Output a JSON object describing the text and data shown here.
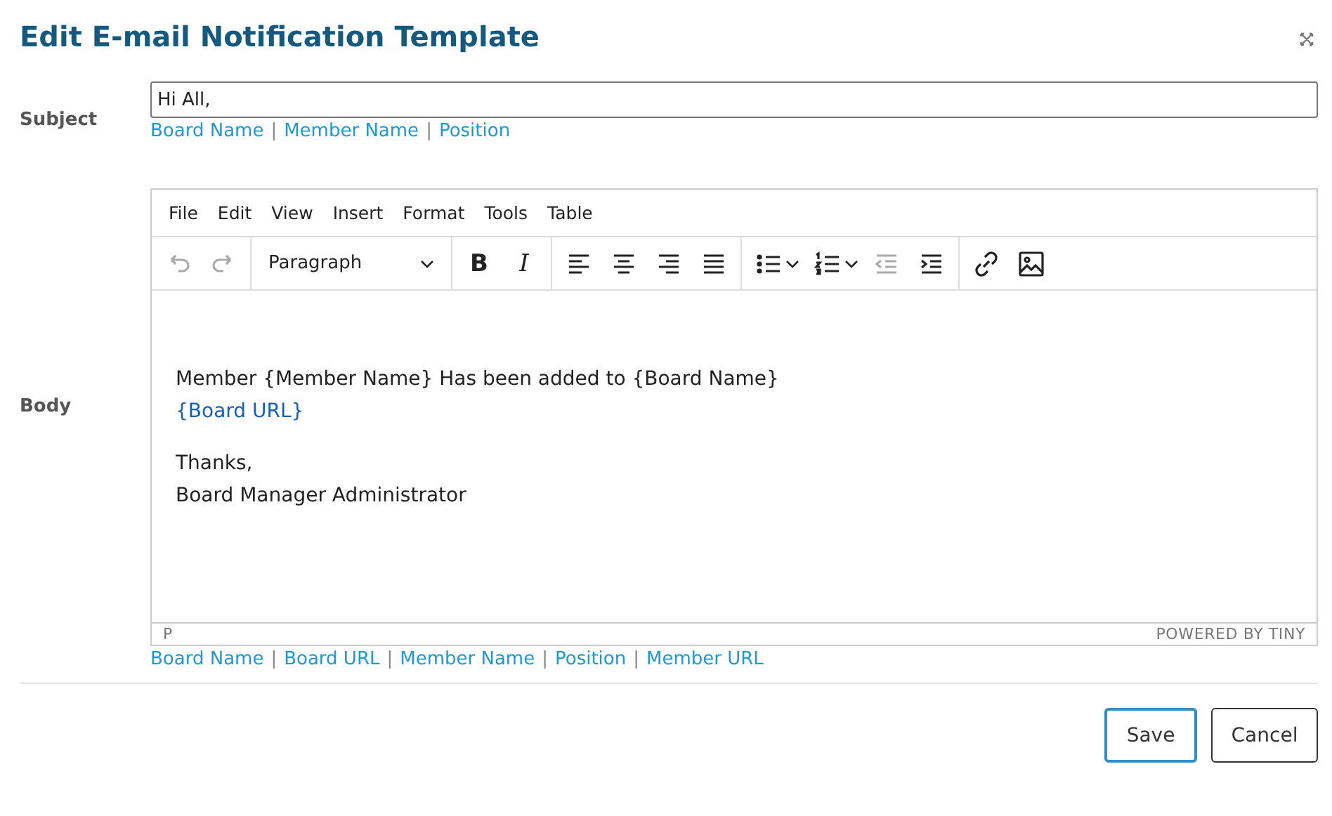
{
  "dialog": {
    "title": "Edit E-mail Notification Template"
  },
  "subject": {
    "label": "Subject",
    "value": "Hi All,",
    "tokens": {
      "separator": "|",
      "items": [
        "Board Name",
        "Member Name",
        "Position"
      ]
    }
  },
  "body": {
    "label": "Body",
    "menu": [
      "File",
      "Edit",
      "View",
      "Insert",
      "Format",
      "Tools",
      "Table"
    ],
    "toolbar": [
      [
        {
          "kind": "undo",
          "disabled": true
        },
        {
          "kind": "redo",
          "disabled": true
        }
      ],
      [
        {
          "kind": "block-format",
          "label": "Paragraph",
          "disabled": false
        }
      ],
      [
        {
          "kind": "bold",
          "label": "B",
          "disabled": false
        },
        {
          "kind": "italic",
          "label": "I",
          "disabled": false
        }
      ],
      [
        {
          "kind": "align-left",
          "disabled": false
        },
        {
          "kind": "align-center",
          "disabled": false
        },
        {
          "kind": "align-right",
          "disabled": false
        },
        {
          "kind": "align-justify",
          "disabled": false
        }
      ],
      [
        {
          "kind": "bullet-list",
          "disabled": false
        },
        {
          "kind": "numbered-list",
          "disabled": false
        },
        {
          "kind": "outdent",
          "disabled": true
        },
        {
          "kind": "indent",
          "disabled": false
        }
      ],
      [
        {
          "kind": "link",
          "disabled": false
        },
        {
          "kind": "image",
          "disabled": false
        }
      ]
    ],
    "paragraphs": [
      [
        {
          "kind": "text",
          "text": "Member {Member Name} Has been added to {Board Name}"
        },
        {
          "kind": "link",
          "text": "{Board URL}"
        }
      ],
      [
        {
          "kind": "text",
          "text": "Thanks,"
        },
        {
          "kind": "text",
          "text": "Board Manager Administrator"
        }
      ]
    ],
    "path": "P",
    "branding": "POWERED BY TINY",
    "tokens": {
      "separator": "|",
      "items": [
        "Board Name",
        "Board URL",
        "Member Name",
        "Position",
        "Member URL"
      ]
    }
  },
  "buttons": [
    {
      "label": "Save",
      "kind": "primary"
    },
    {
      "label": "Cancel",
      "kind": "secondary"
    }
  ]
}
